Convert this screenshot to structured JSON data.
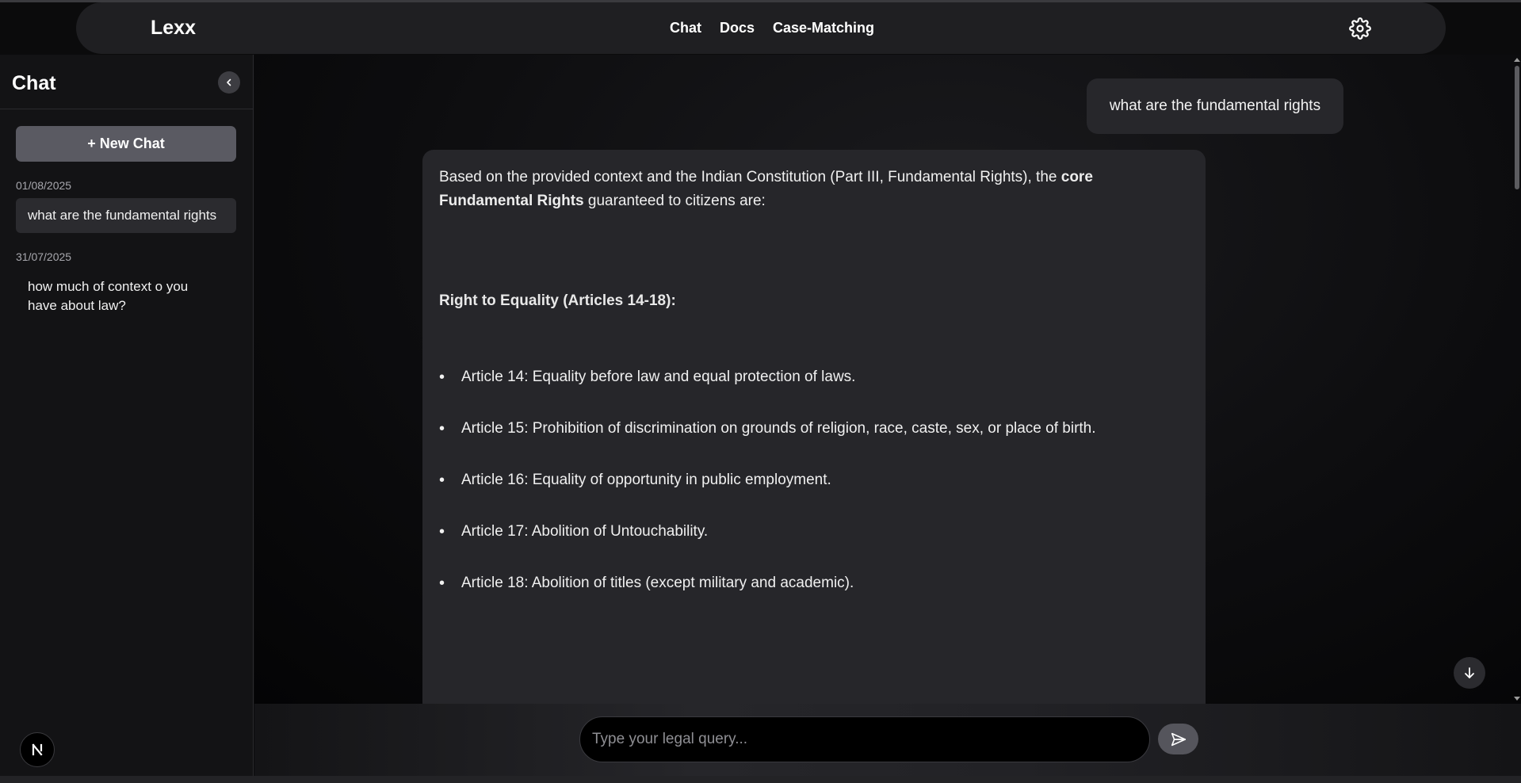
{
  "navbar": {
    "brand": "Lexx",
    "links": [
      "Chat",
      "Docs",
      "Case-Matching"
    ],
    "settings_icon": "gear-icon"
  },
  "sidebar": {
    "title": "Chat",
    "collapse_icon": "chevron-left-icon",
    "new_chat_label": "+ New Chat",
    "groups": [
      {
        "date": "01/08/2025",
        "items": [
          "what are the fundamental rights"
        ]
      },
      {
        "date": "31/07/2025",
        "items": [
          "how much of context o you have about law?"
        ]
      }
    ],
    "avatar_letter": "N"
  },
  "conversation": {
    "user_message": "what are the fundamental rights",
    "ai_intro_1": "Based on the provided context and the Indian Constitution (Part III, Fundamental Rights), the ",
    "ai_intro_bold": "core Fundamental Rights",
    "ai_intro_2": " guaranteed to citizens are:",
    "section_heading": "Right to Equality (Articles 14-18):",
    "articles": [
      "Article 14: Equality before law and equal protection of laws.",
      "Article 15: Prohibition of discrimination on grounds of religion, race, caste, sex, or place of birth.",
      "Article 16: Equality of opportunity in public employment.",
      "Article 17: Abolition of Untouchability.",
      "Article 18: Abolition of titles (except military and academic)."
    ]
  },
  "composer": {
    "placeholder": "Type your legal query...",
    "send_icon": "send-icon"
  },
  "colors": {
    "background": "#0b0b0c",
    "sidebar": "#131315",
    "bubble": "#26262a",
    "new_chat_button": "#5a5a62"
  }
}
